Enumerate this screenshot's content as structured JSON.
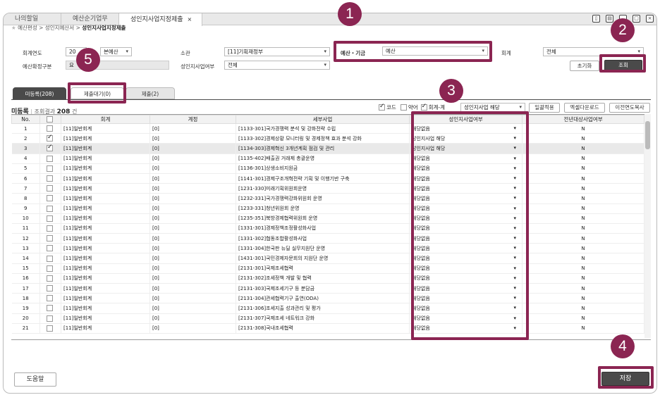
{
  "tabs": [
    {
      "label": "나의할일"
    },
    {
      "label": "예산순기업무"
    },
    {
      "label": "성인지사업지정제출",
      "close": "×"
    }
  ],
  "breadcrumb": {
    "items": [
      "예산편성",
      "성인지예산서"
    ],
    "current": "성인지사업지정제출",
    "sep": ">"
  },
  "form": {
    "year_label": "회계연도",
    "year_value": "20",
    "type_value": "본예산",
    "gubun_label": "예산확정구분",
    "gubun_value": "요",
    "ministry_label": "소관",
    "ministry_value": "[11]기획재정부",
    "gender_label": "성인지사업여부",
    "gender_value": "전체",
    "budget_label": "예산・기금",
    "budget_value": "예산",
    "account_label": "회계",
    "account_value": "전체"
  },
  "buttons": {
    "reset": "초기화",
    "search": "조회",
    "help": "도움말",
    "save": "저장",
    "apply_all": "일괄적용",
    "excel": "엑셀다운로드",
    "copy_prev": "이전연도복사"
  },
  "subtabs": [
    {
      "label": "미등록(208)"
    },
    {
      "label": "제출대기(0)"
    },
    {
      "label": "제출(2)"
    }
  ],
  "list": {
    "title": "미등록",
    "count_label": "조회결과",
    "count": "208",
    "unit": "건"
  },
  "options": {
    "code": "코드",
    "abbr": "약어",
    "account": "회계-계",
    "bulk_value": "성인지사업 해당"
  },
  "columns": [
    "No.",
    "",
    "회계",
    "계정",
    "세부사업",
    "성인지사업여부",
    "전년대상사업여부"
  ],
  "rows": [
    {
      "no": "1",
      "chk": false,
      "acct": "[11]일반회계",
      "sub": "[0]",
      "biz": "[1133-301]국가경쟁력 분석 및 강화전략 수립",
      "gender": "해당없음",
      "prev": "N"
    },
    {
      "no": "2",
      "chk": true,
      "acct": "[11]일반회계",
      "sub": "[0]",
      "biz": "[1133-302]경제상황 모니터링 및 경제정책 효과 분석 강화",
      "gender": "성인지사업 해당",
      "prev": "N"
    },
    {
      "no": "3",
      "chk": true,
      "acct": "[11]일반회계",
      "sub": "[0]",
      "biz": "[1134-303]경제혁신 3개년계획 점검 및 관리",
      "gender": "성인지사업 해당",
      "prev": "N"
    },
    {
      "no": "4",
      "chk": false,
      "acct": "[11]일반회계",
      "sub": "[0]",
      "biz": "[1135-402]배출권 거래제 총괄운영",
      "gender": "해당없음",
      "prev": "N"
    },
    {
      "no": "5",
      "chk": false,
      "acct": "[11]일반회계",
      "sub": "[0]",
      "biz": "[1136-301]상생소비지원금",
      "gender": "해당없음",
      "prev": "N"
    },
    {
      "no": "6",
      "chk": false,
      "acct": "[11]일반회계",
      "sub": "[0]",
      "biz": "[1141-301]경제구조개혁전략 기획 및 이행기반 구축",
      "gender": "해당없음",
      "prev": "N"
    },
    {
      "no": "7",
      "chk": false,
      "acct": "[11]일반회계",
      "sub": "[0]",
      "biz": "[1231-330]미래기획위원회운영",
      "gender": "해당없음",
      "prev": "N"
    },
    {
      "no": "8",
      "chk": false,
      "acct": "[11]일반회계",
      "sub": "[0]",
      "biz": "[1232-331]국가경쟁력강화위원회 운영",
      "gender": "해당없음",
      "prev": "N"
    },
    {
      "no": "9",
      "chk": false,
      "acct": "[11]일반회계",
      "sub": "[0]",
      "biz": "[1233-331]청년위원회 운영",
      "gender": "해당없음",
      "prev": "N"
    },
    {
      "no": "10",
      "chk": false,
      "acct": "[11]일반회계",
      "sub": "[0]",
      "biz": "[1235-351]북방경제협력위원회 운영",
      "gender": "해당없음",
      "prev": "N"
    },
    {
      "no": "11",
      "chk": false,
      "acct": "[11]일반회계",
      "sub": "[0]",
      "biz": "[1331-301]경제정책조정활성화사업",
      "gender": "해당없음",
      "prev": "N"
    },
    {
      "no": "12",
      "chk": false,
      "acct": "[11]일반회계",
      "sub": "[0]",
      "biz": "[1331-302]협동조합활성화사업",
      "gender": "해당없음",
      "prev": "N"
    },
    {
      "no": "13",
      "chk": false,
      "acct": "[11]일반회계",
      "sub": "[0]",
      "biz": "[1331-304]한국판 뉴딜 실무지원단 운영",
      "gender": "해당없음",
      "prev": "N"
    },
    {
      "no": "14",
      "chk": false,
      "acct": "[11]일반회계",
      "sub": "[0]",
      "biz": "[1431-301]국민경제자문회의 지원단 운영",
      "gender": "해당없음",
      "prev": "N"
    },
    {
      "no": "15",
      "chk": false,
      "acct": "[11]일반회계",
      "sub": "[0]",
      "biz": "[2131-301]국제조세협력",
      "gender": "해당없음",
      "prev": "N"
    },
    {
      "no": "16",
      "chk": false,
      "acct": "[11]일반회계",
      "sub": "[0]",
      "biz": "[2131-302]조세정책 개발 및 협력",
      "gender": "해당없음",
      "prev": "N"
    },
    {
      "no": "17",
      "chk": false,
      "acct": "[11]일반회계",
      "sub": "[0]",
      "biz": "[2131-303]국제조세기구 등 분담금",
      "gender": "해당없음",
      "prev": "N"
    },
    {
      "no": "18",
      "chk": false,
      "acct": "[11]일반회계",
      "sub": "[0]",
      "biz": "[2131-304]관세협력기구 출연(ODA)",
      "gender": "해당없음",
      "prev": "N"
    },
    {
      "no": "19",
      "chk": false,
      "acct": "[11]일반회계",
      "sub": "[0]",
      "biz": "[2131-306]조세지출 성과관리 및 평가",
      "gender": "해당없음",
      "prev": "N"
    },
    {
      "no": "20",
      "chk": false,
      "acct": "[11]일반회계",
      "sub": "[0]",
      "biz": "[2131-307]국제조세 네트워크 강화",
      "gender": "해당없음",
      "prev": "N"
    },
    {
      "no": "21",
      "chk": false,
      "acct": "[11]일반회계",
      "sub": "[0]",
      "biz": "[2131-308]국내조세협력",
      "gender": "해당없음",
      "prev": "N"
    }
  ],
  "markers": [
    "1",
    "2",
    "3",
    "4",
    "5"
  ],
  "colors": {
    "accent": "#8b2552",
    "dark_button": "#4a4a4a"
  }
}
